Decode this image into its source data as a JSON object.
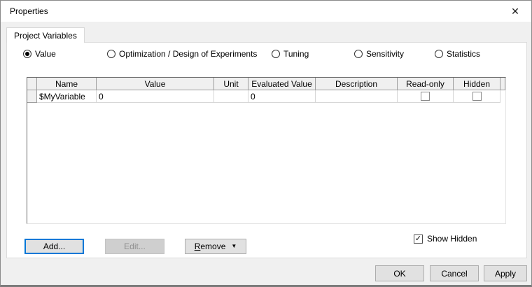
{
  "window": {
    "title": "Properties"
  },
  "icons": {
    "close": "✕",
    "dropdown": "▼",
    "check": "✓"
  },
  "tabs": [
    {
      "label": "Project Variables",
      "selected": true
    }
  ],
  "radios": [
    {
      "label": "Value",
      "selected": true
    },
    {
      "label": "Optimization / Design of Experiments",
      "selected": false
    },
    {
      "label": "Tuning",
      "selected": false
    },
    {
      "label": "Sensitivity",
      "selected": false
    },
    {
      "label": "Statistics",
      "selected": false
    }
  ],
  "grid": {
    "columns": [
      "Name",
      "Value",
      "Unit",
      "Evaluated Value",
      "Description",
      "Read-only",
      "Hidden"
    ],
    "rows": [
      {
        "name": "$MyVariable",
        "value": "0",
        "unit": "",
        "evaluated_value": "0",
        "description": "",
        "read_only": false,
        "hidden": false
      }
    ]
  },
  "actions": {
    "add": "Add...",
    "edit": "Edit...",
    "remove": "Remove",
    "edit_enabled": false,
    "add_focused": true
  },
  "show_hidden": {
    "label": "Show Hidden",
    "checked": true
  },
  "footer": {
    "ok": "OK",
    "cancel": "Cancel",
    "apply": "Apply"
  },
  "colors": {
    "focus_blue": "#0078d7",
    "button_face": "#e1e1e1",
    "button_border": "#adadad",
    "header_gray": "#f0f0f0",
    "gridline_light": "#d6d6d6",
    "gridline_dark": "#9d9d9d"
  }
}
